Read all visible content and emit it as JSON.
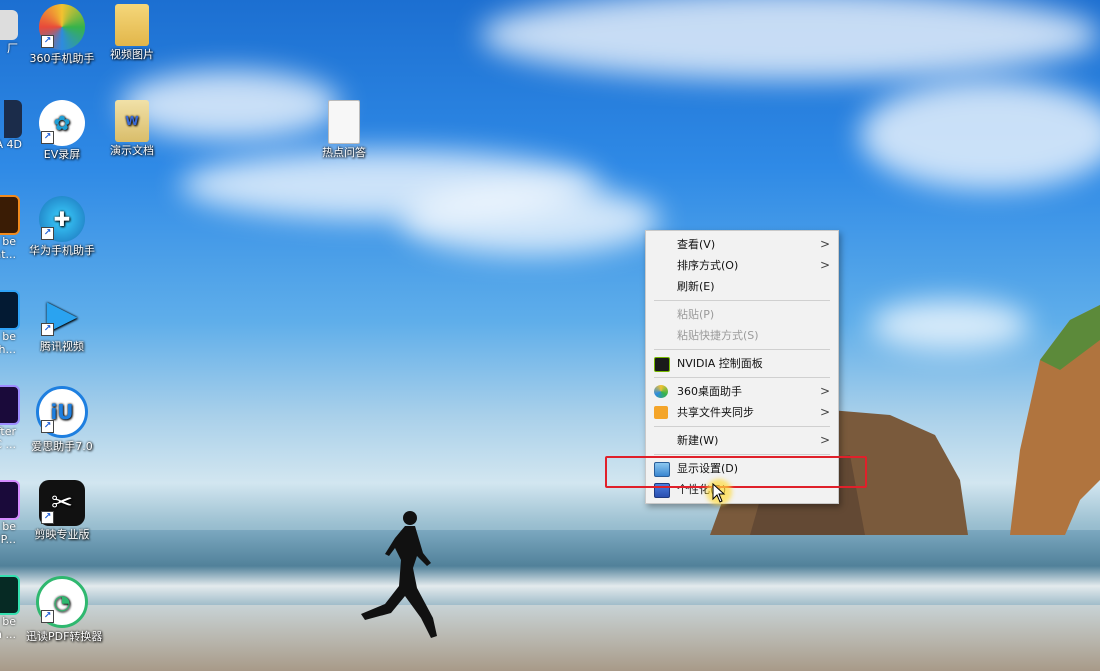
{
  "desktop": {
    "icons": [
      {
        "label": "360手机助手",
        "icon": "360-phone-assistant-icon",
        "color": "#36b34a"
      },
      {
        "label": "视频图片",
        "icon": "folder-icon",
        "color": "#e8c35a"
      },
      {
        "label": "EV录屏",
        "icon": "ev-recorder-icon",
        "color": "#1f9fd6"
      },
      {
        "label": "演示文档",
        "icon": "document-icon",
        "color": "#e9d38a"
      },
      {
        "label": "热点问答",
        "icon": "text-file-icon",
        "color": "#ffffff"
      },
      {
        "label": "华为手机助手",
        "icon": "huawei-assistant-icon",
        "color": "#1e88c9"
      },
      {
        "label": "腾讯视频",
        "icon": "tencent-video-icon",
        "color": "#2aa3f0"
      },
      {
        "label": "爱思助手7.0",
        "icon": "i4-assistant-icon",
        "color": "#1e7fe0"
      },
      {
        "label": "剪映专业版",
        "icon": "jianying-icon",
        "color": "#111111"
      },
      {
        "label": "迅读PDF转换器",
        "icon": "pdf-converter-icon",
        "color": "#2fb86f"
      }
    ],
    "clipped_labels": {
      "row1": "厂",
      "row2": "A 4D",
      "row3a": "be",
      "row3b": "at...",
      "row4a": "be",
      "row4b": "sh...",
      "row5a": "After",
      "row5b": "CC ...",
      "row6a": "be",
      "row6b": "re P...",
      "row7a": "be",
      "row7b": "h ..."
    }
  },
  "context_menu": {
    "items": [
      {
        "label": "查看(V)",
        "has_submenu": true,
        "disabled": false
      },
      {
        "label": "排序方式(O)",
        "has_submenu": true,
        "disabled": false
      },
      {
        "label": "刷新(E)",
        "has_submenu": false,
        "disabled": false
      },
      {
        "label": "粘贴(P)",
        "has_submenu": false,
        "disabled": true
      },
      {
        "label": "粘贴快捷方式(S)",
        "has_submenu": false,
        "disabled": true
      },
      {
        "label": "NVIDIA 控制面板",
        "has_submenu": false,
        "disabled": false,
        "icon": "nvidia-icon"
      },
      {
        "label": "360桌面助手",
        "has_submenu": true,
        "disabled": false,
        "icon": "360-desktop-icon"
      },
      {
        "label": "共享文件夹同步",
        "has_submenu": true,
        "disabled": false,
        "icon": "sync-folder-icon"
      },
      {
        "label": "新建(W)",
        "has_submenu": true,
        "disabled": false
      },
      {
        "label": "显示设置(D)",
        "has_submenu": false,
        "disabled": false,
        "icon": "display-settings-icon",
        "highlighted": true
      },
      {
        "label": "个性化(R)",
        "has_submenu": false,
        "disabled": false,
        "icon": "personalize-icon"
      }
    ],
    "arrow_glyph": ">"
  },
  "colors": {
    "highlight_box": "#e0202a",
    "menu_bg": "#f2f2f2"
  }
}
